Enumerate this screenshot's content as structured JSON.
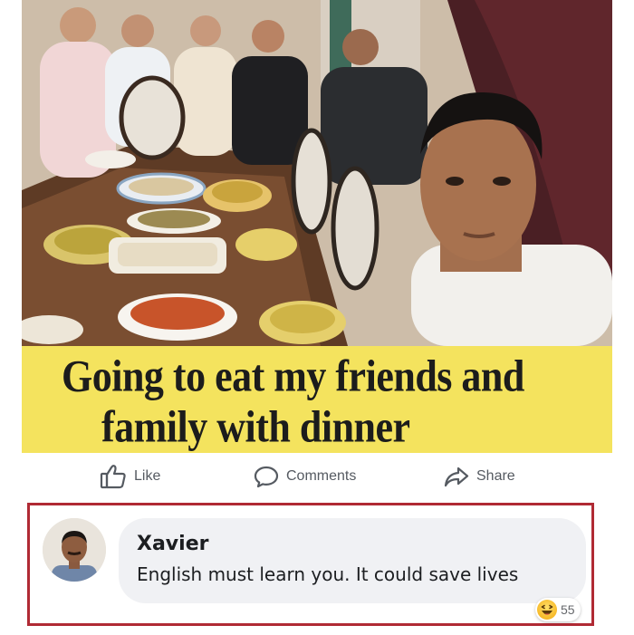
{
  "meme": {
    "caption_line1": "Going to eat my friends and",
    "caption_line2": "family with dinner"
  },
  "actions": {
    "like_label": "Like",
    "comments_label": "Comments",
    "share_label": "Share"
  },
  "comment": {
    "author": "Xavier",
    "text": "English must learn you. It could save lives",
    "reaction_icon": "haha-icon",
    "reaction_count": "55"
  },
  "colors": {
    "caption_background": "#f4e35e",
    "comment_highlight_border": "#b02a34",
    "comment_bubble": "#f0f1f4"
  }
}
